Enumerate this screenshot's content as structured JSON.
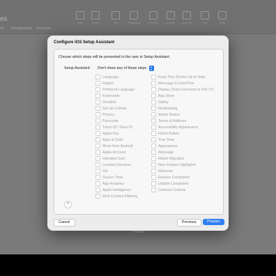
{
  "background": {
    "window_title": "es",
    "toolbar": [
      {
        "icon": "add-icon",
        "label": "Add"
      },
      {
        "icon": "share-icon",
        "label": "Share"
      },
      {
        "icon": "info-icon",
        "label": "Info"
      },
      {
        "icon": "blueprint-icon",
        "label": "Blueprints"
      },
      {
        "icon": "prepare-icon",
        "label": "Prepare"
      },
      {
        "icon": "update-icon",
        "label": "Update"
      },
      {
        "icon": "backup-icon",
        "label": "Back Up"
      },
      {
        "icon": "tag-icon",
        "label": "Tag"
      },
      {
        "icon": "help-icon",
        "label": "Help"
      }
    ],
    "tabs": [
      "ed",
      "Unsupervised",
      "Recovery"
    ],
    "device_label": "iPhone"
  },
  "dialog": {
    "title": "Configure iOS Setup Assistant",
    "description": "Choose which steps will be presented to the user in Setup Assistant.",
    "setup_assistant_label": "Setup Assistant:",
    "setup_assistant_value": "Don't show any of these steps",
    "left_items": [
      {
        "label": "Language",
        "checked": false
      },
      {
        "label": "Region",
        "checked": false
      },
      {
        "label": "Preferred Language",
        "checked": false
      },
      {
        "label": "Keyboards",
        "checked": false
      },
      {
        "label": "Dictation",
        "checked": false
      },
      {
        "label": "Set Up Cellular",
        "checked": false
      },
      {
        "label": "Privacy",
        "checked": false
      },
      {
        "label": "Passcode",
        "checked": false
      },
      {
        "label": "Touch ID / Face ID",
        "checked": false
      },
      {
        "label": "Apple Pay",
        "checked": false
      },
      {
        "label": "Apps & Data",
        "checked": false
      },
      {
        "label": "Move from Android",
        "checked": false
      },
      {
        "label": "Apple Account",
        "checked": false
      },
      {
        "label": "Intended User",
        "checked": false
      },
      {
        "label": "Location Services",
        "checked": false
      },
      {
        "label": "Siri",
        "checked": false
      },
      {
        "label": "Screen Time",
        "checked": false
      },
      {
        "label": "App Analytics",
        "checked": false
      },
      {
        "label": "Apple Intelligence",
        "checked": false
      },
      {
        "label": "Web Content Filtering",
        "checked": false
      }
    ],
    "right_items": [
      {
        "label": "Keep Your Device Up to Date",
        "checked": false
      },
      {
        "label": "iMessage & FaceTime",
        "checked": false
      },
      {
        "label": "Display Zoom (removed in iOS 17)",
        "checked": false
      },
      {
        "label": "App Store",
        "checked": false
      },
      {
        "label": "Safety",
        "checked": false
      },
      {
        "label": "Multitasking",
        "checked": false
      },
      {
        "label": "Action Button",
        "checked": false
      },
      {
        "label": "Terms of Address",
        "checked": false
      },
      {
        "label": "Accessibility Appearance",
        "checked": false
      },
      {
        "label": "Home Button",
        "checked": false
      },
      {
        "label": "True Tone",
        "checked": false
      },
      {
        "label": "Appearance",
        "checked": false
      },
      {
        "label": "iMessage",
        "checked": false
      },
      {
        "label": "Watch Migration",
        "checked": false
      },
      {
        "label": "New Feature Highlights",
        "checked": false
      },
      {
        "label": "Welcome",
        "checked": false
      },
      {
        "label": "Restore Completed",
        "checked": false
      },
      {
        "label": "Update Completed",
        "checked": false
      },
      {
        "label": "Camera Controls",
        "checked": false
      }
    ],
    "help_label": "?",
    "cancel_label": "Cancel",
    "previous_label": "Previous",
    "prepare_label": "Prepare"
  }
}
